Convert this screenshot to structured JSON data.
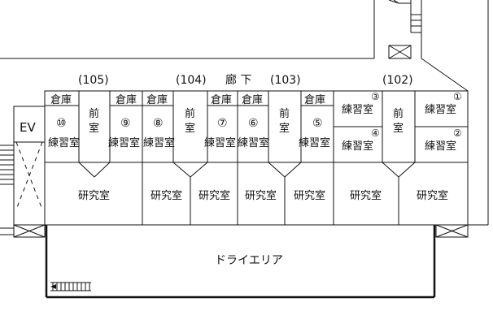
{
  "corridor": {
    "label": "廊 下"
  },
  "room_numbers": {
    "r105": "(105)",
    "r104": "(104)",
    "r103": "(103)",
    "r102": "(102)"
  },
  "ev": {
    "label": "EV"
  },
  "storage": {
    "label": "倉庫"
  },
  "anteroom": {
    "label_top": "前",
    "label_bottom": "室"
  },
  "practice": {
    "label": "練習室"
  },
  "research": {
    "label": "研究室"
  },
  "dry_area": {
    "label": "ドライエリア"
  },
  "practice_numbers": {
    "n1": "①",
    "n2": "②",
    "n3": "③",
    "n4": "④",
    "n5": "⑤",
    "n6": "⑥",
    "n7": "⑦",
    "n8": "⑧",
    "n9": "⑨",
    "n10": "⑩"
  }
}
